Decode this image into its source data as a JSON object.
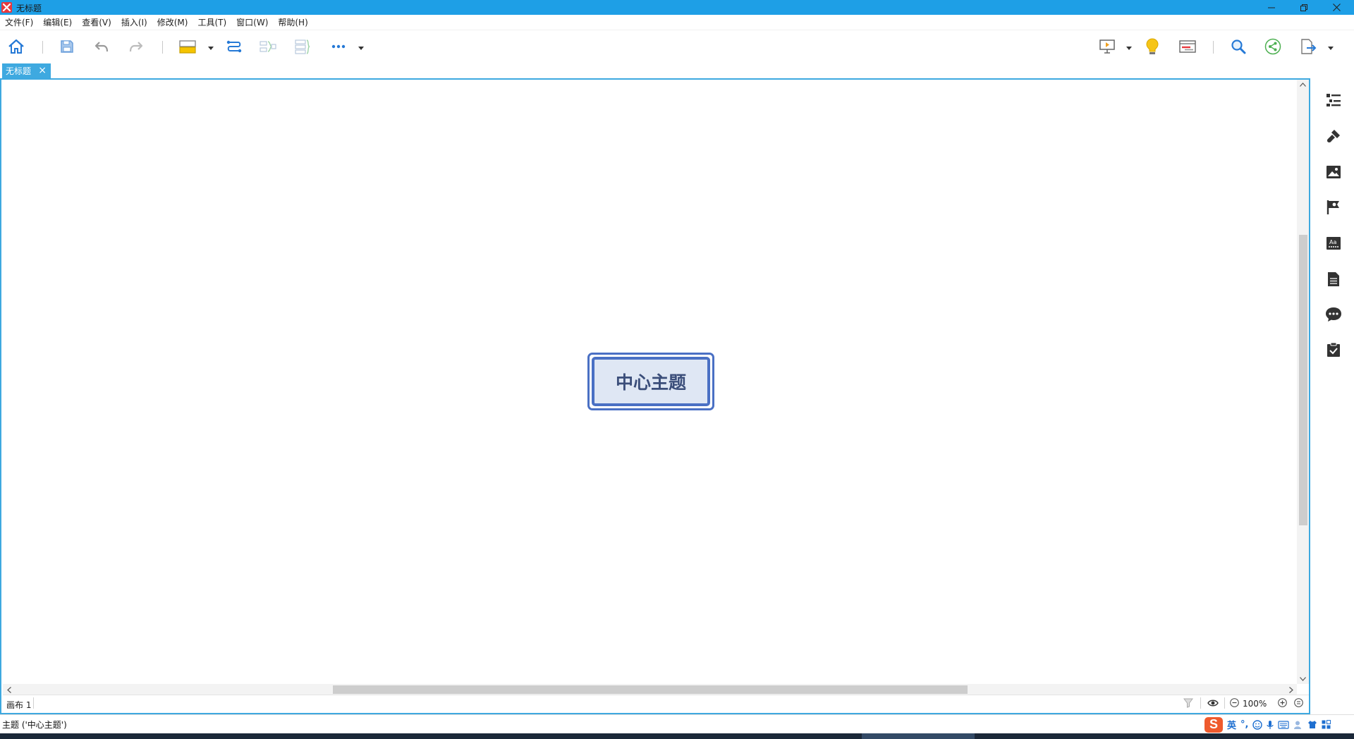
{
  "window": {
    "title": "无标题",
    "controls": [
      "minimize-icon",
      "restore-icon",
      "close-icon"
    ]
  },
  "menu": [
    {
      "label": "文件(F)"
    },
    {
      "label": "编辑(E)"
    },
    {
      "label": "查看(V)"
    },
    {
      "label": "插入(I)"
    },
    {
      "label": "修改(M)"
    },
    {
      "label": "工具(T)"
    },
    {
      "label": "窗口(W)"
    },
    {
      "label": "帮助(H)"
    }
  ],
  "toolbar": {
    "left_icons": [
      "home-icon",
      "save-icon",
      "undo-icon",
      "redo-icon",
      "topic-icon",
      "relationship-icon",
      "summary-icon",
      "boundary-icon",
      "more-icon"
    ],
    "right_icons": [
      "presentation-icon",
      "brainstorm-icon",
      "gantt-icon",
      "search-icon",
      "share-icon",
      "export-icon"
    ]
  },
  "tabs": [
    {
      "label": "无标题",
      "close": "×"
    }
  ],
  "canvas": {
    "central_topic": "中心主题"
  },
  "sheet": {
    "label": "画布 1",
    "zoom": "100%"
  },
  "sidebar_icons": [
    "outline-icon",
    "format-icon",
    "image-icon",
    "marker-icon",
    "text-style-icon",
    "notes-icon",
    "comment-icon",
    "task-icon"
  ],
  "status": {
    "text": "主题 ('中心主题')"
  },
  "ime": {
    "lang": "英",
    "punct": "°,"
  },
  "colors": {
    "titlebar": "#1e9fe6",
    "accent": "#3ea9e0",
    "topic_border": "#4a70c4",
    "topic_fill": "#dfe7f4",
    "topic_text": "#3b4e7a"
  }
}
